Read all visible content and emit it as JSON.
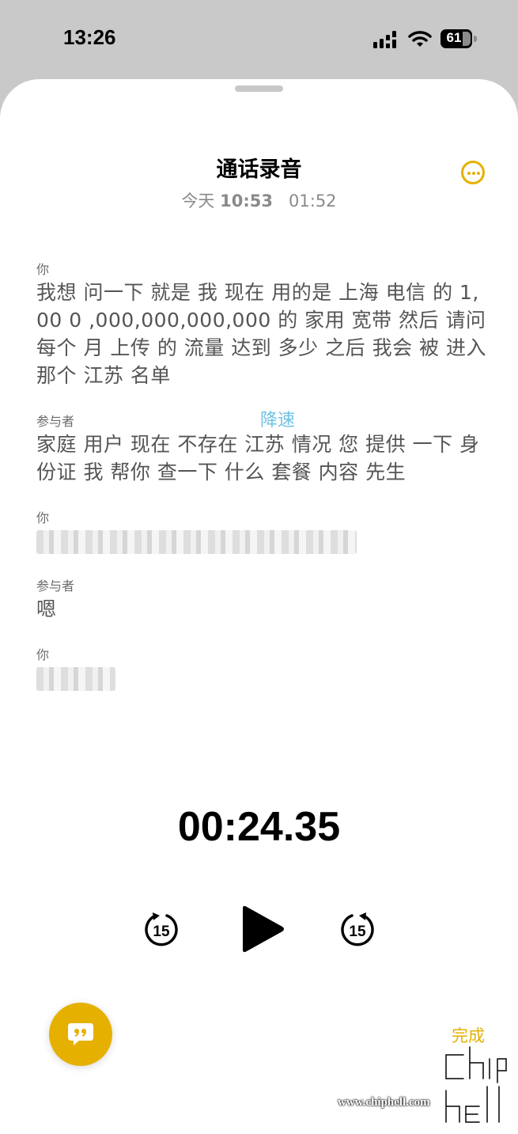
{
  "status_bar": {
    "time": "13:26",
    "battery": "61"
  },
  "header": {
    "title": "通话录音",
    "date_prefix": "今天",
    "date_time": "10:53",
    "duration": "01:52"
  },
  "transcript": [
    {
      "speaker": "你",
      "text": "我想 问一下 就是 我 现在 用的是 上海 电信 的 1,00 0 ,000,000,000,000 的 家用 宽带 然后 请问 每个 月 上传 的 流量 达到 多少 之后 我会 被 进入 那个 江苏 名单"
    },
    {
      "speaker": "参与者",
      "text": "家庭 用户 现在 不存在 江苏 情况 您 提供 一下 身份证 我 帮你 查一下 什么 套餐 内容 先生"
    },
    {
      "speaker": "你",
      "text": ""
    },
    {
      "speaker": "参与者",
      "text": "嗯"
    },
    {
      "speaker": "你",
      "text": ""
    }
  ],
  "overlay_label": "降速",
  "player": {
    "elapsed": "00:24.35",
    "skip_back": "15",
    "skip_forward": "15"
  },
  "footer": {
    "done_label": "完成"
  },
  "watermark": {
    "site": "www.chiphell.com"
  },
  "colors": {
    "accent": "#e6b000",
    "overlay": "#6ec3e6"
  },
  "icons": [
    "cellular-signal-icon",
    "wifi-icon",
    "battery-icon",
    "more-options-icon",
    "skip-back-15-icon",
    "play-icon",
    "skip-forward-15-icon",
    "quote-bubble-icon"
  ]
}
